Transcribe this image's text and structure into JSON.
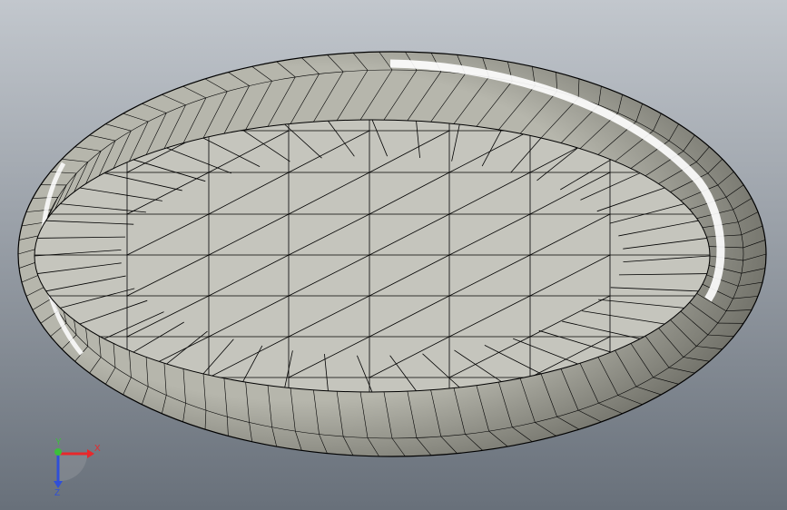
{
  "viewport": {
    "background_top": "#c2c7cd",
    "background_bottom": "#68707a"
  },
  "model": {
    "face_color": "#c5c5bd",
    "wall_color_light": "#b6b6ac",
    "wall_color_dark": "#4f4f48",
    "edge_color": "#000000",
    "highlight_color": "#ffffff"
  },
  "triad": {
    "x_label": "X",
    "y_label": "Y",
    "z_label": "Z",
    "x_color": "#e8282b",
    "y_color": "#3bbf3b",
    "z_color": "#2f4fd8"
  }
}
